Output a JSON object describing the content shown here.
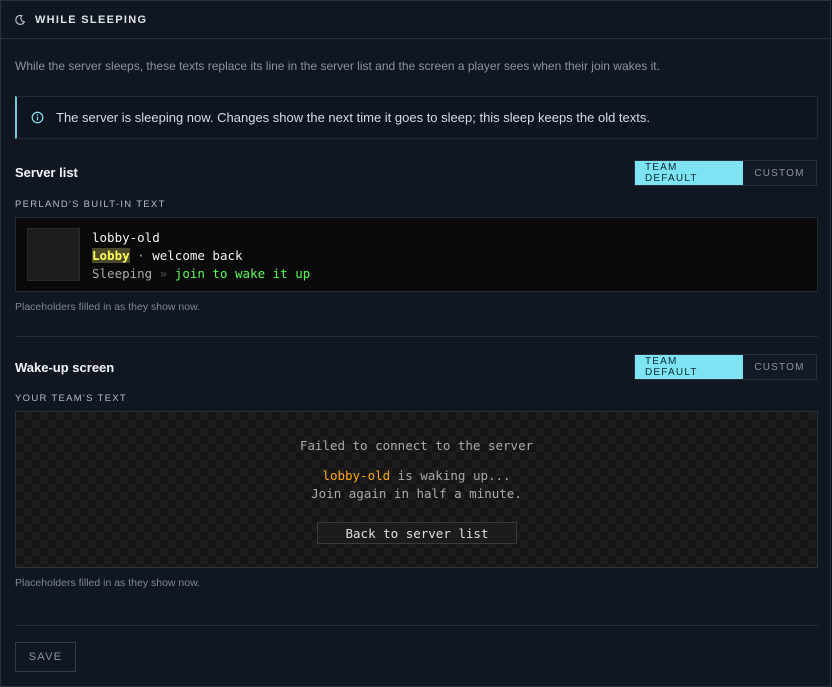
{
  "header": {
    "icon": "moon-icon",
    "title": "WHILE SLEEPING"
  },
  "intro": "While the server sleeps, these texts replace its line in the server list and the screen a player sees when their join wakes it.",
  "notice": {
    "icon": "info-icon",
    "text": "The server is sleeping now. Changes show the next time it goes to sleep; this sleep keeps the old texts.",
    "accent": "#6dc9d9"
  },
  "server_list": {
    "title": "Server list",
    "toggle": {
      "options": [
        "TEAM DEFAULT",
        "CUSTOM"
      ],
      "selected": "TEAM DEFAULT"
    },
    "source_label": "PERLAND'S BUILT-IN TEXT",
    "preview": {
      "name": "lobby-old",
      "motd_highlight": "Lobby",
      "motd_sep": " · ",
      "motd_rest": "welcome back",
      "status": "Sleeping",
      "status_sep": " » ",
      "status_action": "join to wake it up"
    },
    "hint": "Placeholders filled in as they show now."
  },
  "wake_screen": {
    "title": "Wake-up screen",
    "toggle": {
      "options": [
        "TEAM DEFAULT",
        "CUSTOM"
      ],
      "selected": "TEAM DEFAULT"
    },
    "source_label": "YOUR TEAM'S TEXT",
    "preview": {
      "heading": "Failed to connect to the server",
      "server_name": "lobby-old",
      "line1_rest": " is waking up...",
      "line2": "Join again in half a minute.",
      "button": "Back to server list"
    },
    "hint": "Placeholders filled in as they show now."
  },
  "save_label": "SAVE",
  "colors": {
    "accent": "#7ee3f2",
    "background": "#111721",
    "highlight": "#ffff55",
    "gold": "#ffaa00",
    "green": "#55ff55"
  }
}
